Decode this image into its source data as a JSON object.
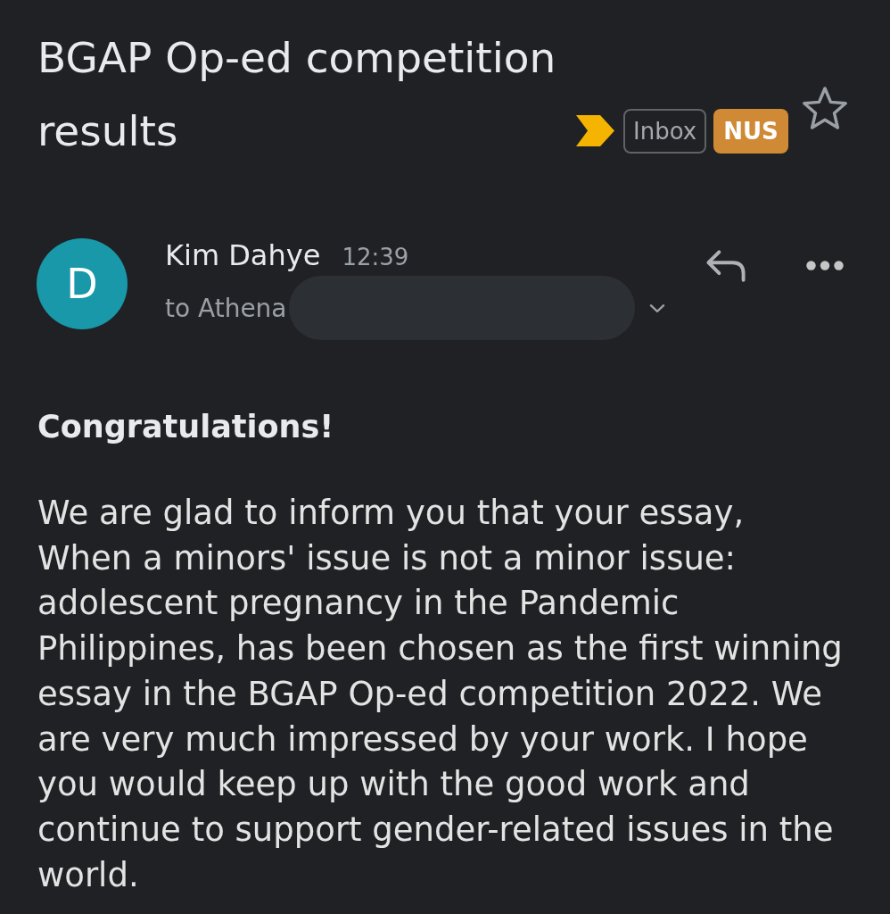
{
  "subject": {
    "title": "BGAP Op-ed competition results",
    "important": true,
    "labels": [
      {
        "text": "Inbox",
        "kind": "outline"
      },
      {
        "text": "NUS",
        "kind": "filled",
        "color": "#d08a35"
      }
    ],
    "starred": false
  },
  "message": {
    "sender": {
      "initial": "D",
      "name": "Kim Dahye"
    },
    "time": "12:39",
    "recipient": "to Athena",
    "recipient_redacted": true,
    "details_expanded": false
  },
  "body": {
    "greeting": "Congratulations!",
    "paragraphs": [
      "We are glad to inform you that your essay,\nWhen a minors' issue is not a minor issue: adolescent pregnancy in the Pandemic Philippines, has been chosen as the first winning essay in the BGAP Op-ed competition 2022. We are very much impressed by your work. I hope you would keep up with the good work and continue to support gender-related issues in the world."
    ]
  }
}
